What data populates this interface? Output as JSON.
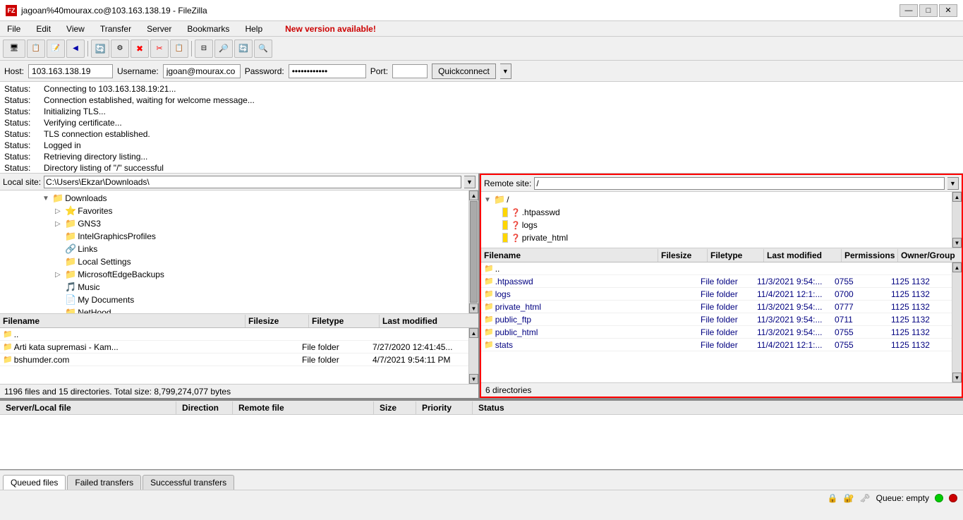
{
  "titleBar": {
    "title": "jagoan%40mourax.co@103.163.138.19 - FileZilla",
    "icon": "FZ"
  },
  "menuBar": {
    "items": [
      "File",
      "Edit",
      "View",
      "Transfer",
      "Server",
      "Bookmarks",
      "Help"
    ],
    "newVersion": "New version available!"
  },
  "connectionBar": {
    "hostLabel": "Host:",
    "hostValue": "103.163.138.19",
    "usernameLabel": "Username:",
    "usernameValue": "jgoan@mourax.co",
    "passwordLabel": "Password:",
    "passwordValue": "••••••••••••",
    "portLabel": "Port:",
    "portValue": "",
    "quickconnectLabel": "Quickconnect"
  },
  "statusMessages": [
    {
      "label": "Status:",
      "text": "Connecting to 103.163.138.19:21..."
    },
    {
      "label": "Status:",
      "text": "Connection established, waiting for welcome message..."
    },
    {
      "label": "Status:",
      "text": "Initializing TLS..."
    },
    {
      "label": "Status:",
      "text": "Verifying certificate..."
    },
    {
      "label": "Status:",
      "text": "TLS connection established."
    },
    {
      "label": "Status:",
      "text": "Logged in"
    },
    {
      "label": "Status:",
      "text": "Retrieving directory listing..."
    },
    {
      "label": "Status:",
      "text": "Directory listing of \"/\" successful"
    }
  ],
  "localPanel": {
    "siteLabel": "Local site:",
    "sitePath": "C:\\Users\\Ekzar\\Downloads\\",
    "treeItems": [
      {
        "label": "Downloads",
        "indent": 1,
        "expanded": true,
        "type": "folder-star"
      },
      {
        "label": "Favorites",
        "indent": 2,
        "expanded": false,
        "type": "folder-star"
      },
      {
        "label": "GNS3",
        "indent": 2,
        "expanded": false,
        "type": "folder"
      },
      {
        "label": "IntelGraphicsProfiles",
        "indent": 2,
        "type": "folder"
      },
      {
        "label": "Links",
        "indent": 2,
        "type": "folder-link"
      },
      {
        "label": "Local Settings",
        "indent": 2,
        "type": "folder"
      },
      {
        "label": "MicrosoftEdgeBackups",
        "indent": 2,
        "expanded": false,
        "type": "folder"
      },
      {
        "label": "Music",
        "indent": 2,
        "type": "folder-music"
      },
      {
        "label": "My Documents",
        "indent": 2,
        "type": "folder-doc"
      },
      {
        "label": "NetHood",
        "indent": 2,
        "type": "folder"
      }
    ],
    "fileColumns": [
      "Filename",
      "Filesize",
      "Filetype",
      "Last modified"
    ],
    "files": [
      {
        "name": "..",
        "size": "",
        "type": "",
        "modified": ""
      },
      {
        "name": "Arti kata supremasi - Kam...",
        "size": "",
        "type": "File folder",
        "modified": "7/27/2020 12:41:45..."
      },
      {
        "name": "bshumder.com",
        "size": "",
        "type": "File folder",
        "modified": "4/7/2021 9:54:11 PM"
      }
    ],
    "statusText": "1196 files and 15 directories. Total size: 8,799,274,077 bytes"
  },
  "remotePanel": {
    "siteLabel": "Remote site:",
    "sitePath": "/",
    "treeItems": [
      {
        "label": "/",
        "indent": 0,
        "expanded": true
      },
      {
        "label": ".htpasswd",
        "indent": 1,
        "type": "unknown"
      },
      {
        "label": "logs",
        "indent": 1,
        "type": "unknown"
      },
      {
        "label": "private_html",
        "indent": 1,
        "type": "unknown"
      }
    ],
    "fileColumns": [
      "Filename",
      "Filesize",
      "Filetype",
      "Last modified",
      "Permissions",
      "Owner/Group"
    ],
    "files": [
      {
        "name": "..",
        "size": "",
        "type": "",
        "modified": "",
        "permissions": "",
        "owner": ""
      },
      {
        "name": ".htpasswd",
        "size": "",
        "type": "File folder",
        "modified": "11/3/2021 9:54:...",
        "permissions": "0755",
        "owner": "1125 1132"
      },
      {
        "name": "logs",
        "size": "",
        "type": "File folder",
        "modified": "11/4/2021 12:1:...",
        "permissions": "0700",
        "owner": "1125 1132"
      },
      {
        "name": "private_html",
        "size": "",
        "type": "File folder",
        "modified": "11/3/2021 9:54:...",
        "permissions": "0777",
        "owner": "1125 1132"
      },
      {
        "name": "public_ftp",
        "size": "",
        "type": "File folder",
        "modified": "11/3/2021 9:54:...",
        "permissions": "0711",
        "owner": "1125 1132"
      },
      {
        "name": "public_html",
        "size": "",
        "type": "File folder",
        "modified": "11/3/2021 9:54:...",
        "permissions": "0755",
        "owner": "1125 1132"
      },
      {
        "name": "stats",
        "size": "",
        "type": "File folder",
        "modified": "11/4/2021 12:1:...",
        "permissions": "0755",
        "owner": "1125 1132"
      }
    ],
    "statusText": "6 directories"
  },
  "queuePanel": {
    "columns": [
      "Server/Local file",
      "Direction",
      "Remote file",
      "Size",
      "Priority",
      "Status"
    ]
  },
  "bottomTabs": {
    "tabs": [
      "Queued files",
      "Failed transfers",
      "Successful transfers"
    ],
    "activeTab": "Queued files"
  },
  "bottomStatus": {
    "queueText": "Queue: empty"
  },
  "toolbar": {
    "buttons": [
      "⬅",
      "⬛",
      "📁",
      "🔄",
      "⚙",
      "✖",
      "✂",
      "📋",
      "🔎",
      "🔄",
      "🔍"
    ]
  }
}
